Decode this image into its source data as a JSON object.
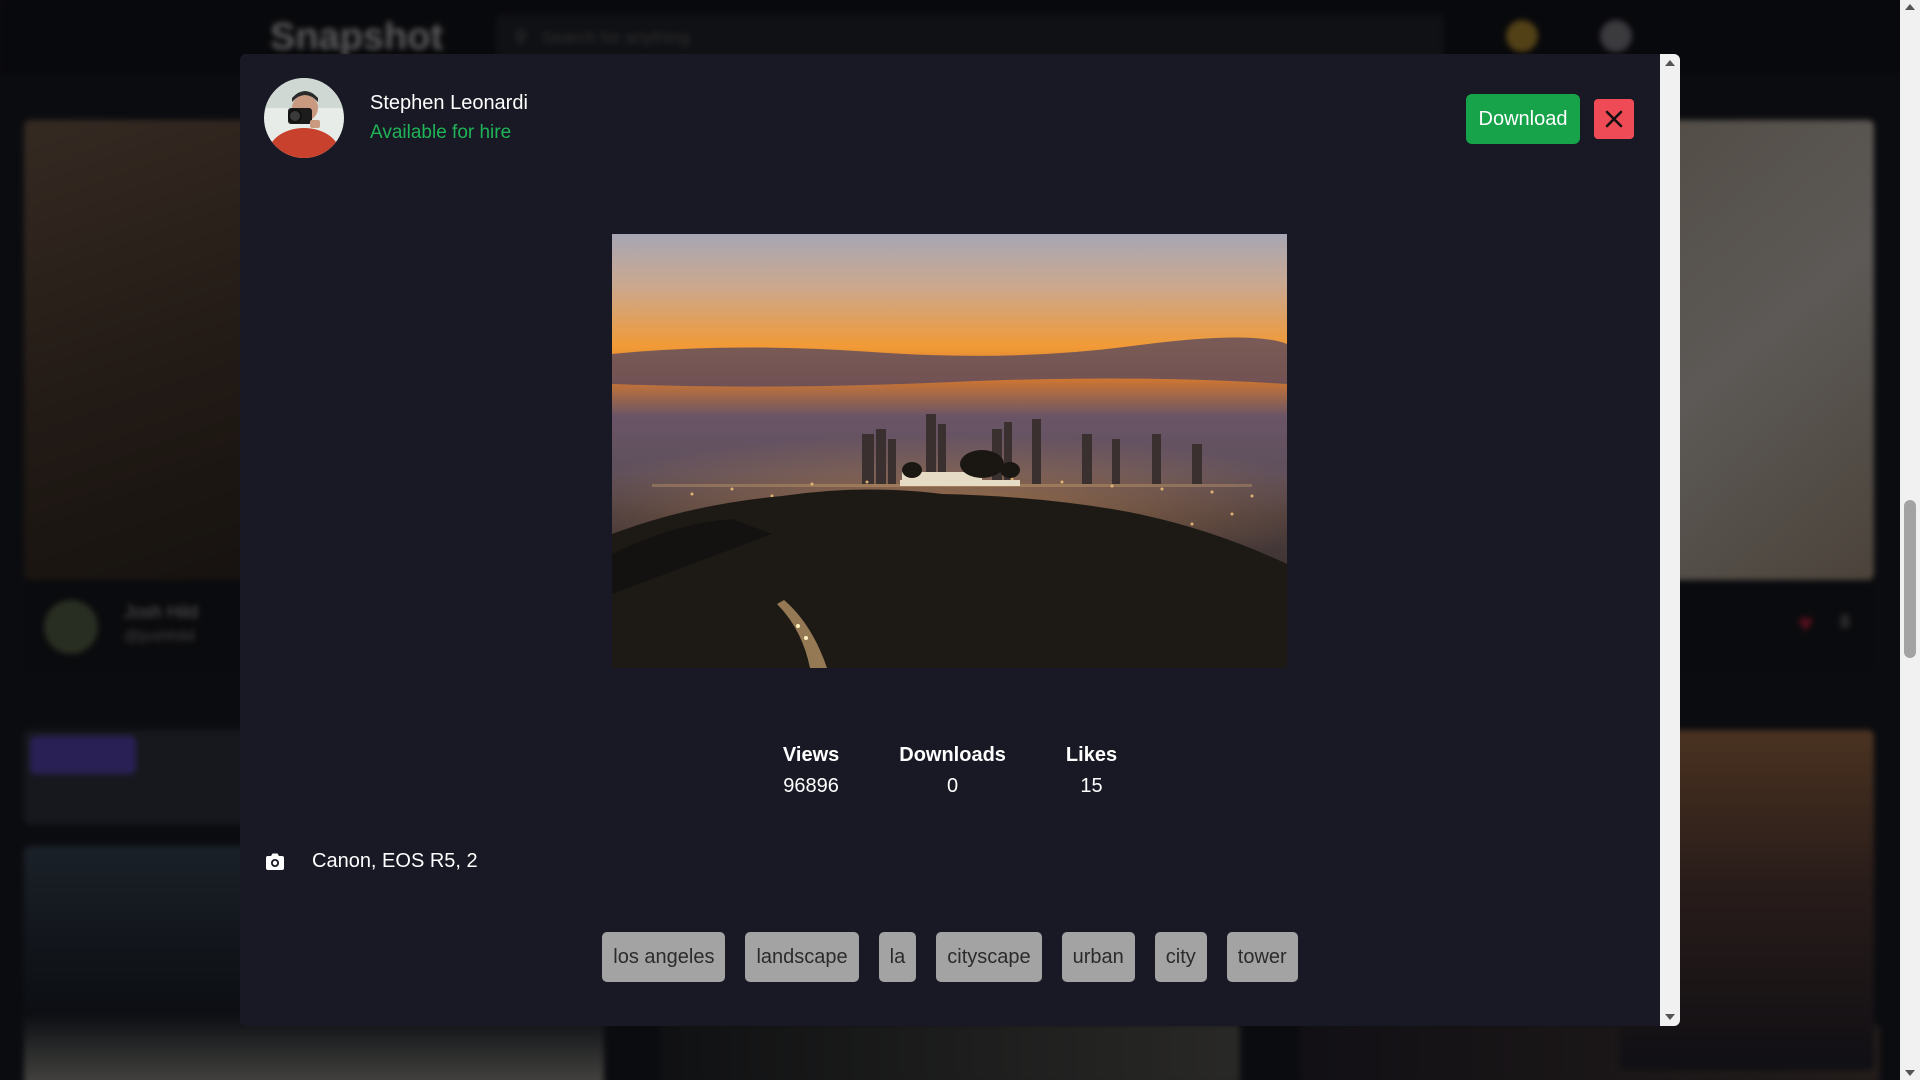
{
  "background": {
    "logo": "Snapshot",
    "search_placeholder": "Search for anything",
    "card_user_name": "Josh Hild",
    "card_user_handle": "@joshhild",
    "card_likes": "8"
  },
  "modal": {
    "user": {
      "name": "Stephen Leonardi",
      "status": "Available for hire"
    },
    "download_label": "Download",
    "stats": [
      {
        "label": "Views",
        "value": "96896"
      },
      {
        "label": "Downloads",
        "value": "0"
      },
      {
        "label": "Likes",
        "value": "15"
      }
    ],
    "camera": "Canon, EOS R5, 2",
    "tags": [
      "los angeles",
      "landscape",
      "la",
      "cityscape",
      "urban",
      "city",
      "tower"
    ]
  },
  "colors": {
    "modal_bg": "#181924",
    "accent_green": "#16a34a",
    "hire_green": "#1fb457",
    "close_red": "#ef4b56",
    "tag_bg": "#a3a3a3"
  },
  "icons": {
    "close": "close-icon",
    "camera": "camera-icon",
    "search": "search-icon",
    "heart": "heart-icon"
  }
}
